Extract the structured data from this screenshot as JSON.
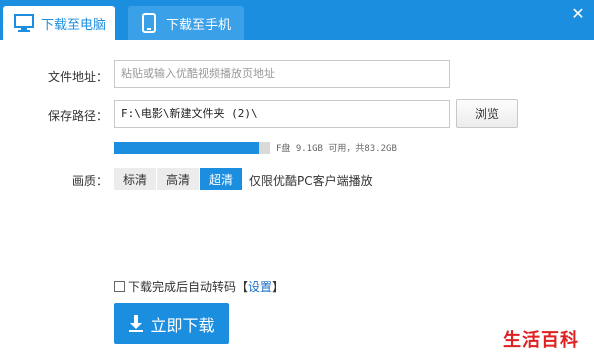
{
  "tabs": [
    {
      "label": "下载至电脑",
      "icon": "monitor-icon",
      "active": true
    },
    {
      "label": "下载至手机",
      "icon": "phone-icon",
      "active": false
    }
  ],
  "colors": {
    "accent": "#1c8ee0",
    "brand_red": "#e02020"
  },
  "form": {
    "address_label": "文件地址：",
    "address_placeholder": "粘贴或输入优酷视频播放页地址",
    "path_label": "保存路径：",
    "path_value": "F:\\电影\\新建文件夹 (2)\\",
    "browse_label": "浏览",
    "disk_usage_fraction": 0.93,
    "disk_info": "F盘 9.1GB 可用，共83.2GB"
  },
  "quality": {
    "label": "画质：",
    "options": [
      "标清",
      "高清",
      "超清"
    ],
    "selected": "超清",
    "note": "仅限优酷PC客户端播放"
  },
  "auto_convert": {
    "label": "下载完成后自动转码【",
    "link": "设置",
    "suffix": "】",
    "checked": false
  },
  "download_button": "立即下载",
  "watermark": "生活百科"
}
